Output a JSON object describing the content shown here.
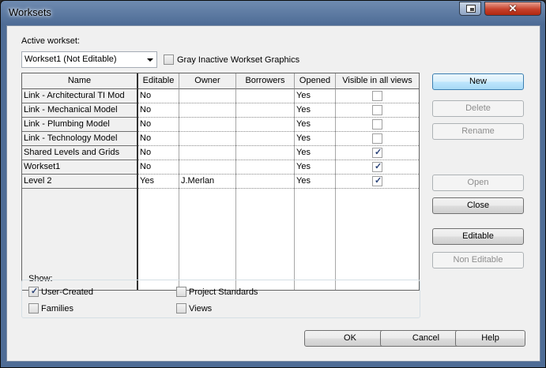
{
  "window": {
    "title": "Worksets"
  },
  "active_workset": {
    "label": "Active workset:",
    "value": "Workset1 (Not Editable)",
    "gray_inactive_label": "Gray Inactive Workset Graphics",
    "gray_inactive_checked": false
  },
  "table": {
    "columns": [
      "Name",
      "Editable",
      "Owner",
      "Borrowers",
      "Opened",
      "Visible in all views"
    ],
    "rows": [
      {
        "name": "Link - Architectural TI Mod",
        "editable": "No",
        "owner": "",
        "borrowers": "",
        "opened": "Yes",
        "visible": false
      },
      {
        "name": "Link - Mechanical Model",
        "editable": "No",
        "owner": "",
        "borrowers": "",
        "opened": "Yes",
        "visible": false
      },
      {
        "name": "Link - Plumbing Model",
        "editable": "No",
        "owner": "",
        "borrowers": "",
        "opened": "Yes",
        "visible": false
      },
      {
        "name": "Link - Technology Model",
        "editable": "No",
        "owner": "",
        "borrowers": "",
        "opened": "Yes",
        "visible": false
      },
      {
        "name": "Shared Levels and Grids",
        "editable": "No",
        "owner": "",
        "borrowers": "",
        "opened": "Yes",
        "visible": true
      },
      {
        "name": "Workset1",
        "editable": "No",
        "owner": "",
        "borrowers": "",
        "opened": "Yes",
        "visible": true
      },
      {
        "name": "Level 2",
        "editable": "Yes",
        "owner": "J.Merlan",
        "borrowers": "",
        "opened": "Yes",
        "visible": true
      }
    ]
  },
  "side_buttons": {
    "new": "New",
    "delete": "Delete",
    "rename": "Rename",
    "open": "Open",
    "close": "Close",
    "editable": "Editable",
    "non_editable": "Non Editable"
  },
  "show": {
    "label": "Show:",
    "user_created": {
      "label": "User-Created",
      "checked": true
    },
    "families": {
      "label": "Families",
      "checked": false
    },
    "project_standards": {
      "label": "Project Standards",
      "checked": false
    },
    "views": {
      "label": "Views",
      "checked": false
    }
  },
  "footer": {
    "ok": "OK",
    "cancel": "Cancel",
    "help": "Help"
  }
}
